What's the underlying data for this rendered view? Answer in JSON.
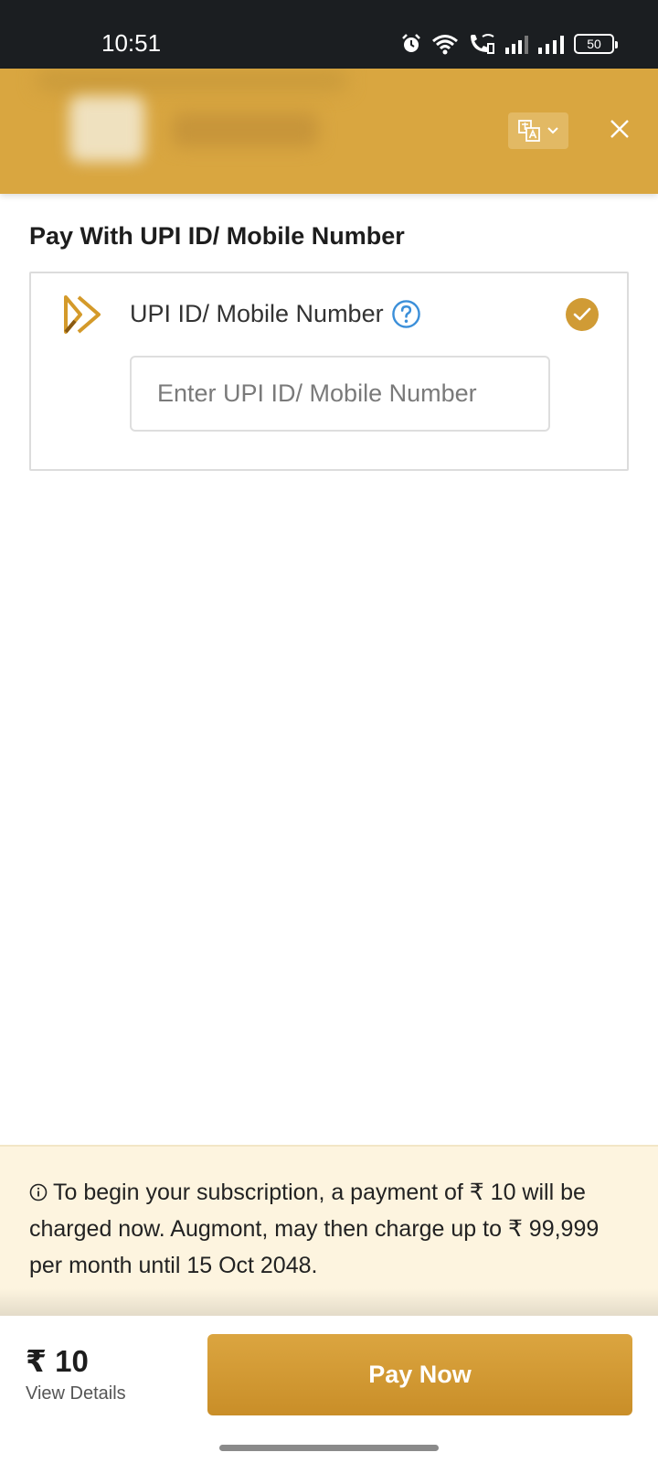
{
  "status_bar": {
    "time": "10:51",
    "battery": "50",
    "icons": [
      "alarm-icon",
      "wifi-icon",
      "wifi-call-icon",
      "signal-icon",
      "signal-icon",
      "battery-icon"
    ]
  },
  "header": {
    "language_icon": "translate-icon",
    "close_icon": "close-icon",
    "background_color": "#d9a640"
  },
  "payment": {
    "section_title": "Pay With UPI ID/ Mobile Number",
    "option_label": "UPI ID/ Mobile Number",
    "input_placeholder": "Enter UPI ID/ Mobile Number",
    "input_value": "",
    "selected": true
  },
  "notice": {
    "text": "To begin your subscription, a payment of ₹ 10 will be charged now. Augmont, may then charge up to ₹ 99,999 per month until 15 Oct 2048."
  },
  "footer": {
    "amount": "₹ 10",
    "view_details": "View Details",
    "pay_button": "Pay Now",
    "accent_color": "#d09b35"
  }
}
